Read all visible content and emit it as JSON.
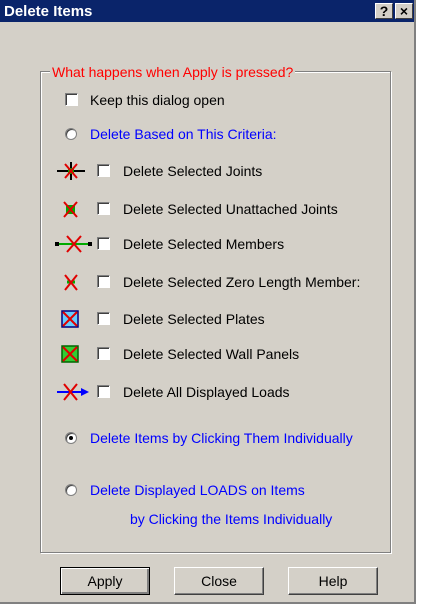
{
  "window": {
    "title": "Delete Items",
    "help_btn": "?",
    "close_btn": "×"
  },
  "group": {
    "legend": "What happens when Apply is pressed?"
  },
  "options": {
    "keep_open": {
      "label": "Keep this dialog open",
      "checked": false
    },
    "criteria_radio": {
      "label": "Delete Based on This Criteria:",
      "selected": false
    },
    "criteria": [
      {
        "label": "Delete Selected Joints",
        "icon": "delete-joints-icon",
        "checked": false
      },
      {
        "label": "Delete Selected Unattached Joints",
        "icon": "delete-unattached-joints-icon",
        "checked": false
      },
      {
        "label": "Delete Selected Members",
        "icon": "delete-members-icon",
        "checked": false
      },
      {
        "label": "Delete Selected Zero Length Member:",
        "icon": "delete-zero-length-icon",
        "checked": false
      },
      {
        "label": "Delete Selected Plates",
        "icon": "delete-plates-icon",
        "checked": false
      },
      {
        "label": "Delete Selected Wall Panels",
        "icon": "delete-wall-panels-icon",
        "checked": false
      },
      {
        "label": "Delete All Displayed Loads",
        "icon": "delete-loads-icon",
        "checked": false
      }
    ],
    "click_individually": {
      "label": "Delete Items by Clicking Them Individually",
      "selected": true
    },
    "loads_radio": {
      "line1": "Delete Displayed LOADS on Items",
      "line2": "by Clicking the Items Individually",
      "selected": false
    }
  },
  "buttons": {
    "apply": "Apply",
    "close": "Close",
    "help": "Help"
  },
  "colors": {
    "title_bar": "#0a246a",
    "face": "#d4d0c8",
    "legend": "#ff0000",
    "radio_text": "#0000ff"
  }
}
